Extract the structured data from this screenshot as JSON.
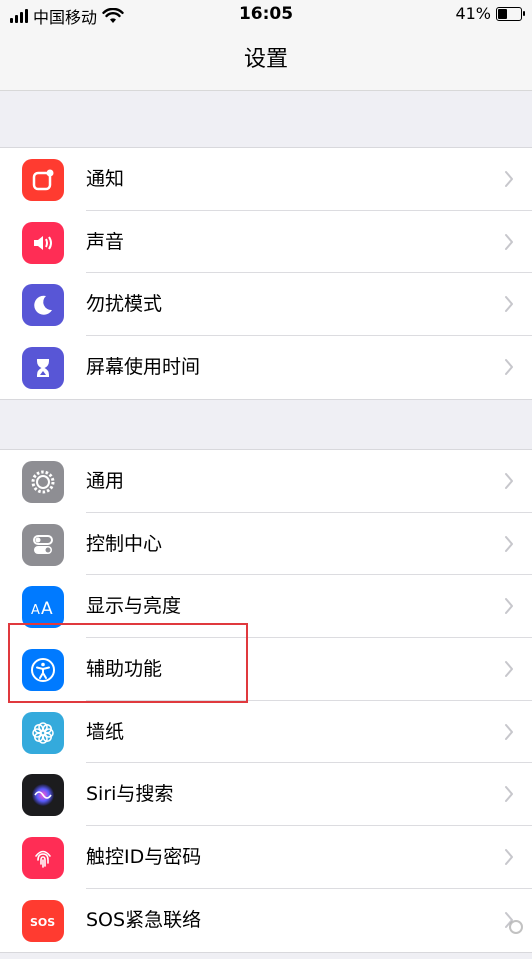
{
  "status": {
    "carrier": "中国移动",
    "time": "16:05",
    "battery_percent": "41%",
    "battery_level": 0.41
  },
  "nav": {
    "title": "设置"
  },
  "group1": [
    {
      "label": "通知",
      "icon": "notification-icon",
      "color": "#ff3b30"
    },
    {
      "label": "声音",
      "icon": "speaker-icon",
      "color": "#ff2d55"
    },
    {
      "label": "勿扰模式",
      "icon": "moon-icon",
      "color": "#5856d6"
    },
    {
      "label": "屏幕使用时间",
      "icon": "hourglass-icon",
      "color": "#5856d6"
    }
  ],
  "group2": [
    {
      "label": "通用",
      "icon": "gear-icon",
      "color": "#8e8e93"
    },
    {
      "label": "控制中心",
      "icon": "toggle-icon",
      "color": "#8e8e93"
    },
    {
      "label": "显示与亮度",
      "icon": "text-size-icon",
      "color": "#007aff"
    },
    {
      "label": "辅助功能",
      "icon": "accessibility-icon",
      "color": "#007aff"
    },
    {
      "label": "墙纸",
      "icon": "flower-icon",
      "color": "#34aadc"
    },
    {
      "label": "Siri与搜索",
      "icon": "siri-icon",
      "color": "#1c1c1e"
    },
    {
      "label": "触控ID与密码",
      "icon": "fingerprint-icon",
      "color": "#ff2d55"
    },
    {
      "label": "SOS紧急联络",
      "icon": "sos-icon",
      "color": "#ff3b30"
    }
  ]
}
